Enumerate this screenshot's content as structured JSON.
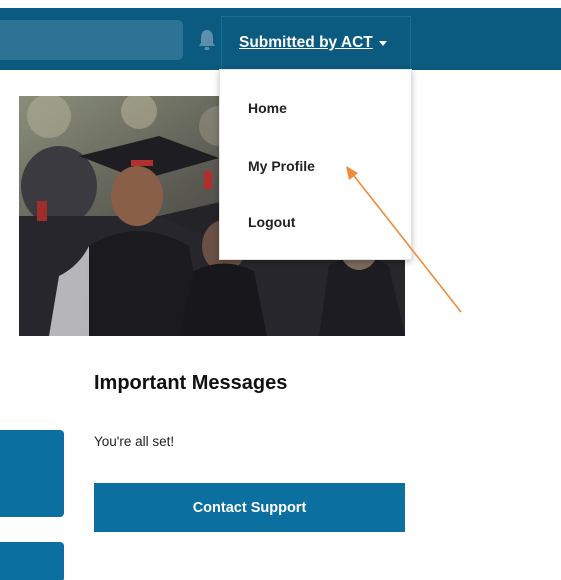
{
  "header": {
    "user_menu_label": "Submitted by ACT",
    "bell_icon": "bell-icon",
    "caret_icon": "caret-down-icon"
  },
  "dropdown": {
    "items": [
      {
        "label": "Home"
      },
      {
        "label": "My Profile"
      },
      {
        "label": "Logout"
      }
    ]
  },
  "hero": {
    "image": "graduates-in-caps-and-gowns"
  },
  "messages": {
    "title": "Important Messages",
    "status_text": "You're all set!",
    "contact_button_label": "Contact Support"
  },
  "colors": {
    "header_bg": "#0b5a80",
    "button_bg": "#0b6fa0",
    "annotation_arrow": "#f08a3c"
  }
}
